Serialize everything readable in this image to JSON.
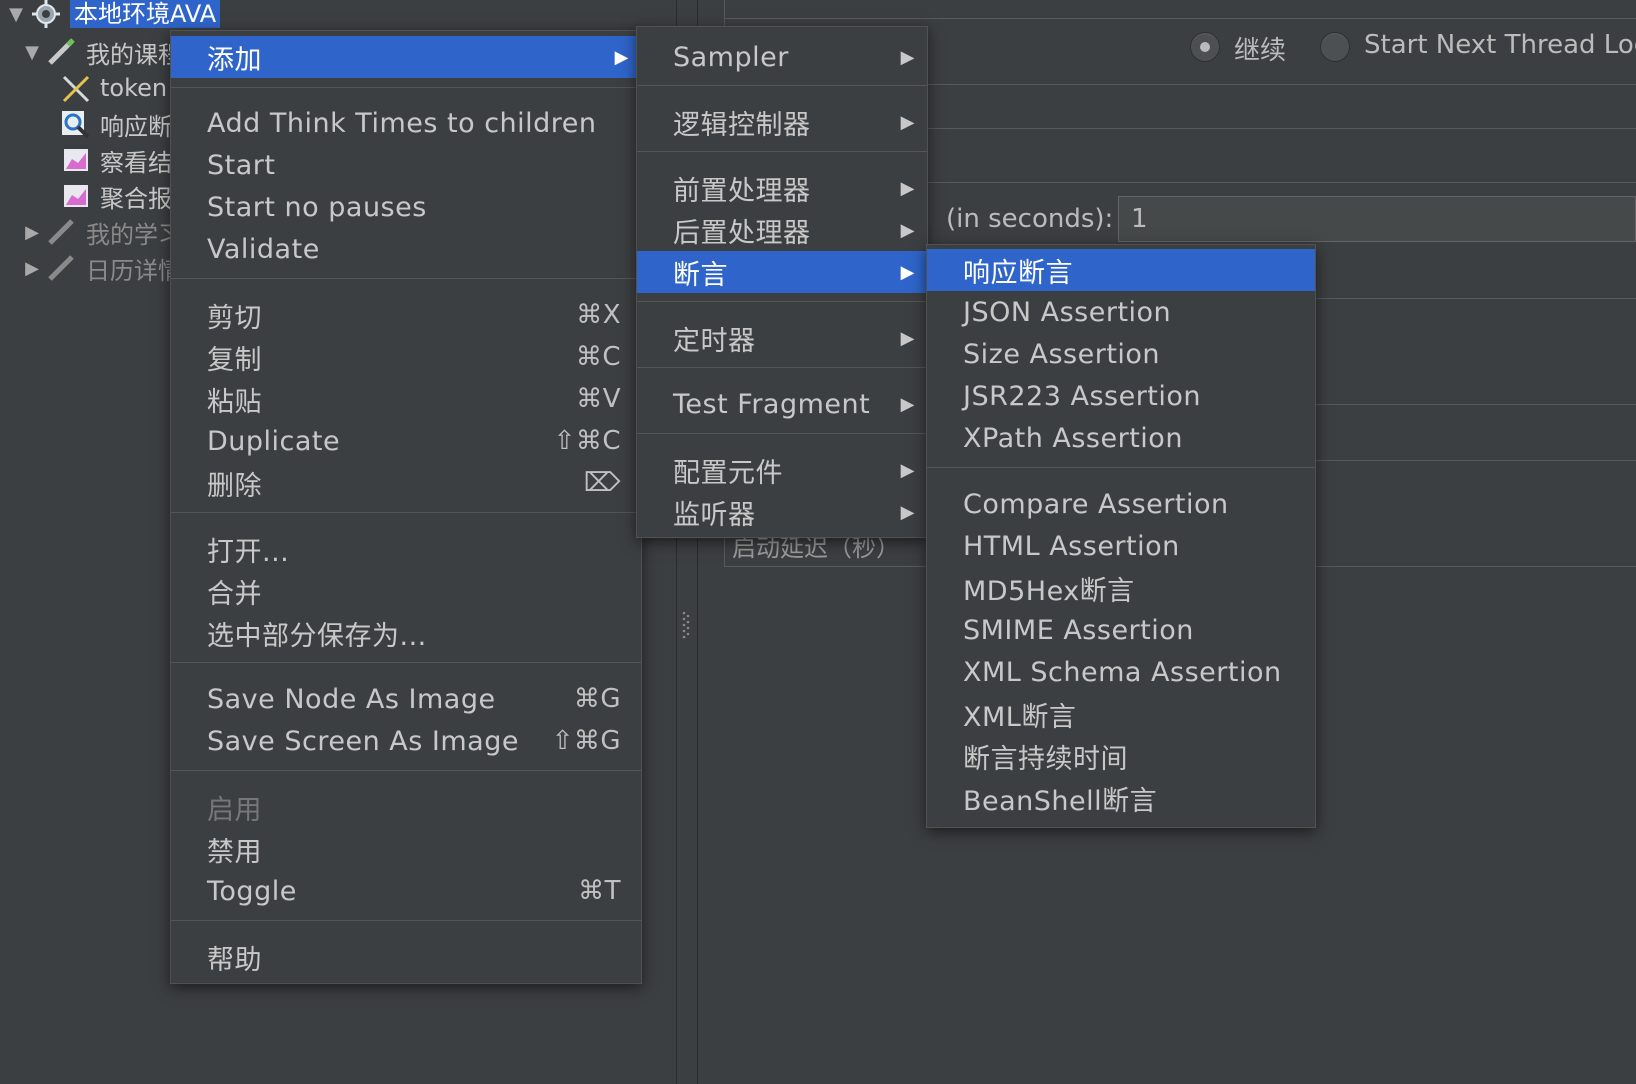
{
  "tree": {
    "root_label": "本地环境AVA",
    "items": [
      {
        "label": "我的课程",
        "icon": "pencil-icon"
      },
      {
        "label": "token",
        "icon": "tools-icon"
      },
      {
        "label": "响应断",
        "icon": "magnifier-icon"
      },
      {
        "label": "察看结",
        "icon": "chart-icon"
      },
      {
        "label": "聚合报",
        "icon": "chart-icon"
      },
      {
        "label": "我的学习",
        "icon": "pencil-icon"
      },
      {
        "label": "日历详情",
        "icon": "pencil-icon"
      }
    ]
  },
  "right_panel": {
    "radio_continue": "继续",
    "radio_next_thread": "Start Next Thread Loop",
    "ramp_label": "(in seconds):",
    "ramp_value": "1",
    "startup_delay_label": "启动延迟（秒）"
  },
  "context_menu": {
    "add": "添加",
    "add_think_times": "Add Think Times to children",
    "start": "Start",
    "start_no_pauses": "Start no pauses",
    "validate": "Validate",
    "cut": "剪切",
    "cut_sc": "⌘X",
    "copy": "复制",
    "copy_sc": "⌘C",
    "paste": "粘贴",
    "paste_sc": "⌘V",
    "duplicate": "Duplicate",
    "duplicate_sc": "⇧⌘C",
    "delete": "删除",
    "delete_sc": "⌦",
    "open": "打开...",
    "merge": "合并",
    "save_selection_as": "选中部分保存为...",
    "save_node_image": "Save Node As Image",
    "save_node_image_sc": "⌘G",
    "save_screen_image": "Save Screen As Image",
    "save_screen_image_sc": "⇧⌘G",
    "enable": "启用",
    "disable": "禁用",
    "toggle": "Toggle",
    "toggle_sc": "⌘T",
    "help": "帮助"
  },
  "add_submenu": {
    "sampler": "Sampler",
    "logic_controller": "逻辑控制器",
    "pre_processor": "前置处理器",
    "post_processor": "后置处理器",
    "assertion": "断言",
    "timer": "定时器",
    "test_fragment": "Test Fragment",
    "config_element": "配置元件",
    "listener": "监听器"
  },
  "assertion_submenu": {
    "items_group1": [
      "响应断言",
      "JSON Assertion",
      "Size Assertion",
      "JSR223 Assertion",
      "XPath Assertion"
    ],
    "items_group2": [
      "Compare Assertion",
      "HTML Assertion",
      "MD5Hex断言",
      "SMIME Assertion",
      "XML Schema Assertion",
      "XML断言",
      "断言持续时间",
      "BeanShell断言"
    ]
  },
  "colors": {
    "background": "#3c3f41",
    "selection": "#2f65ca",
    "text": "#bbbbbb"
  }
}
